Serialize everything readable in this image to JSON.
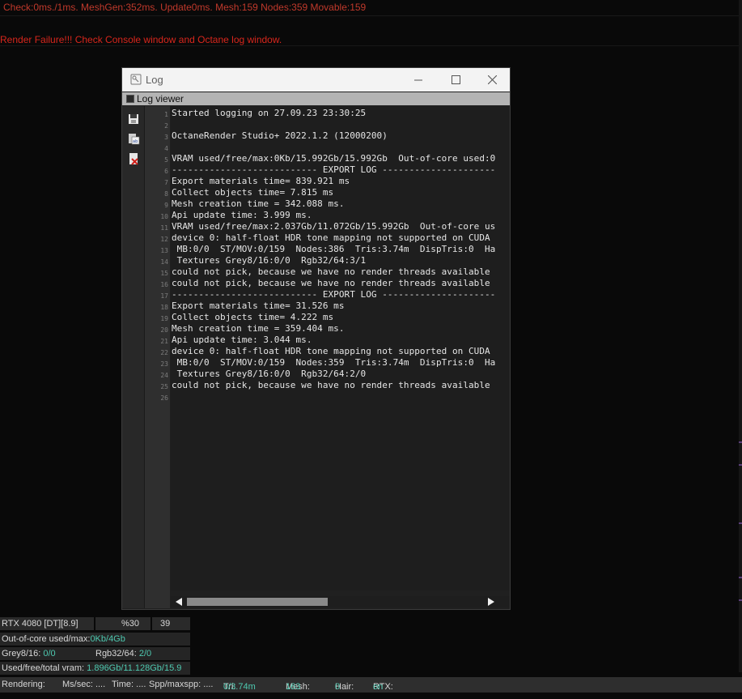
{
  "top_status": "Check:0ms./1ms. MeshGen:352ms. Update0ms. Mesh:159 Nodes:359 Movable:159",
  "render_failure": "Render Failure!!! Check Console window and Octane log window.",
  "log_window": {
    "title": "Log",
    "tab_label": "Log viewer",
    "toolbar": [
      "save-icon",
      "copy-icon",
      "clear-icon"
    ],
    "lines": [
      "Started logging on 27.09.23 23:30:25",
      "",
      "OctaneRender Studio+ 2022.1.2 (12000200)",
      "",
      "VRAM used/free/max:0Kb/15.992Gb/15.992Gb  Out-of-core used:0",
      "--------------------------- EXPORT LOG ---------------------",
      "Export materials time= 839.921 ms",
      "Collect objects time= 7.815 ms",
      "Mesh creation time = 342.088 ms.",
      "Api update time: 3.999 ms.",
      "VRAM used/free/max:2.037Gb/11.072Gb/15.992Gb  Out-of-core us",
      "device 0: half-float HDR tone mapping not supported on CUDA",
      " MB:0/0  ST/MOV:0/159  Nodes:386  Tris:3.74m  DispTris:0  Ha",
      " Textures Grey8/16:0/0  Rgb32/64:3/1",
      "could not pick, because we have no render threads available",
      "could not pick, because we have no render threads available",
      "--------------------------- EXPORT LOG ---------------------",
      "Export materials time= 31.526 ms",
      "Collect objects time= 4.222 ms",
      "Mesh creation time = 359.404 ms.",
      "Api update time: 3.044 ms.",
      "device 0: half-float HDR tone mapping not supported on CUDA",
      " MB:0/0  ST/MOV:0/159  Nodes:359  Tris:3.74m  DispTris:0  Ha",
      " Textures Grey8/16:0/0  Rgb32/64:2/0",
      "could not pick, because we have no render threads available",
      ""
    ],
    "line_numbers": [
      "1",
      "2",
      "3",
      "4",
      "5",
      "6",
      "7",
      "8",
      "9",
      "10",
      "11",
      "12",
      "13",
      "14",
      "15",
      "16",
      "17",
      "18",
      "19",
      "20",
      "21",
      "22",
      "23",
      "24",
      "25",
      "26"
    ]
  },
  "gpu": {
    "name": "RTX 4080 [DT][8.9]",
    "percent": "%30",
    "temp": "39"
  },
  "stats": {
    "out_of_core_label": "Out-of-core used/max:",
    "out_of_core_value": "0Kb/4Gb",
    "grey_label": "Grey8/16: ",
    "grey_value": "0/0",
    "rgb_label": "Rgb32/64: ",
    "rgb_value": "2/0",
    "vram_label": "Used/free/total vram: ",
    "vram_value": "1.896Gb/11.128Gb/15.9"
  },
  "status_bar": {
    "rendering": "Rendering:",
    "ms_sec": "Ms/sec: ....",
    "time": "Time: ....",
    "spp": "Spp/maxspp: ....",
    "tri_label": "Tri: ",
    "tri_value": "0/3.74m",
    "mesh_label": "Mesh: ",
    "mesh_value": "163",
    "hair_label": "Hair: ",
    "hair_value": "0",
    "rtx_label": "RTX:",
    "rtx_value": "on"
  },
  "colors": {
    "error": "#d8261c",
    "accent": "#4ec9b0"
  }
}
